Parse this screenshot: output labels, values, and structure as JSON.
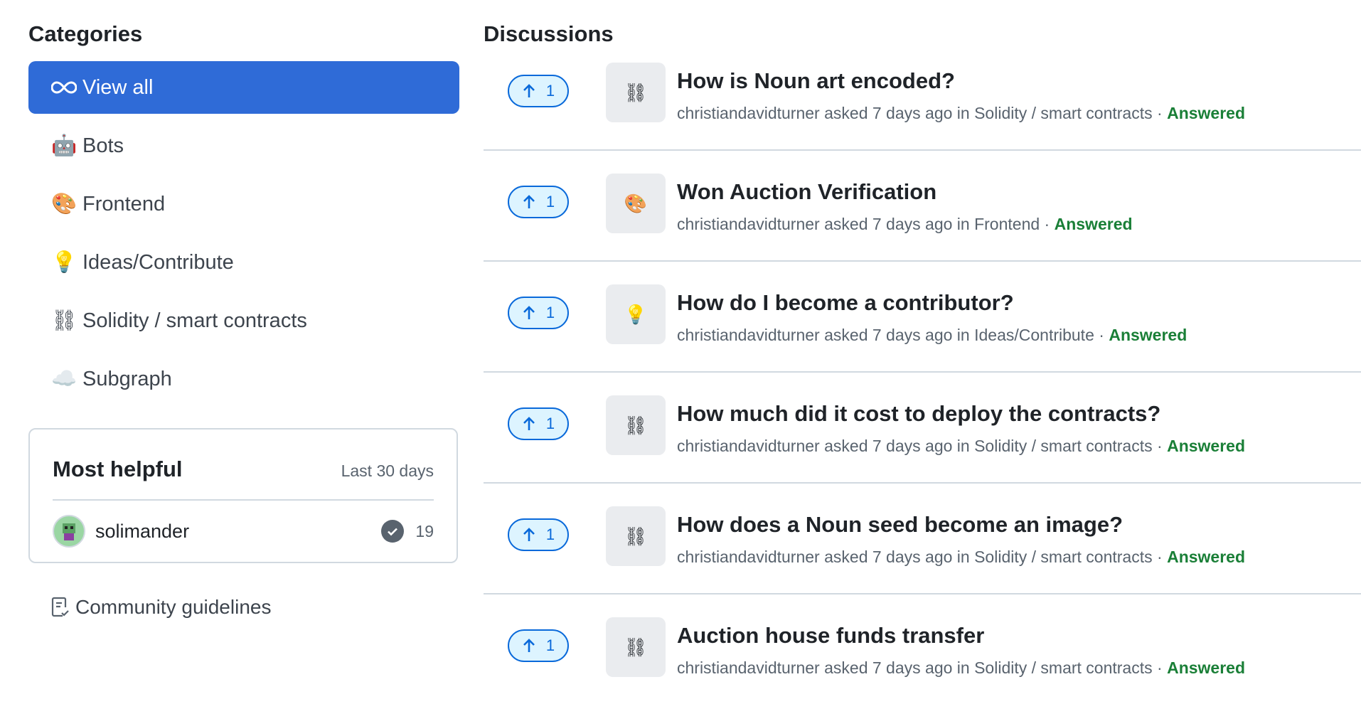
{
  "sidebar": {
    "title": "Categories",
    "items": [
      {
        "label": "View all",
        "icon": "infinity-icon"
      },
      {
        "label": "Bots",
        "icon": "🤖"
      },
      {
        "label": "Frontend",
        "icon": "🎨"
      },
      {
        "label": "Ideas/Contribute",
        "icon": "💡"
      },
      {
        "label": "Solidity / smart contracts",
        "icon": "⛓"
      },
      {
        "label": "Subgraph",
        "icon": "☁️"
      }
    ],
    "most_helpful": {
      "title": "Most helpful",
      "range": "Last 30 days",
      "user": {
        "name": "solimander",
        "count": "19"
      }
    },
    "guidelines_label": "Community guidelines"
  },
  "main": {
    "title": "Discussions",
    "discussions": [
      {
        "title": "How is Noun art encoded?",
        "author": "christiandavidturner",
        "asked": "asked 7 days ago in",
        "category": "Solidity / smart contracts",
        "status": "Answered",
        "votes": "1",
        "icon": "⛓"
      },
      {
        "title": "Won Auction Verification",
        "author": "christiandavidturner",
        "asked": "asked 7 days ago in",
        "category": "Frontend",
        "status": "Answered",
        "votes": "1",
        "icon": "🎨"
      },
      {
        "title": "How do I become a contributor?",
        "author": "christiandavidturner",
        "asked": "asked 7 days ago in",
        "category": "Ideas/Contribute",
        "status": "Answered",
        "votes": "1",
        "icon": "💡"
      },
      {
        "title": "How much did it cost to deploy the contracts?",
        "author": "christiandavidturner",
        "asked": "asked 7 days ago in",
        "category": "Solidity / smart contracts",
        "status": "Answered",
        "votes": "1",
        "icon": "⛓"
      },
      {
        "title": "How does a Noun seed become an image?",
        "author": "christiandavidturner",
        "asked": "asked 7 days ago in",
        "category": "Solidity / smart contracts",
        "status": "Answered",
        "votes": "1",
        "icon": "⛓"
      },
      {
        "title": "Auction house funds transfer",
        "author": "christiandavidturner",
        "asked": "asked 7 days ago in",
        "category": "Solidity / smart contracts",
        "status": "Answered",
        "votes": "1",
        "icon": "⛓"
      }
    ]
  },
  "colors": {
    "accent": "#2f6bd7",
    "answered": "#1a7f37",
    "vote": "#0969da"
  }
}
